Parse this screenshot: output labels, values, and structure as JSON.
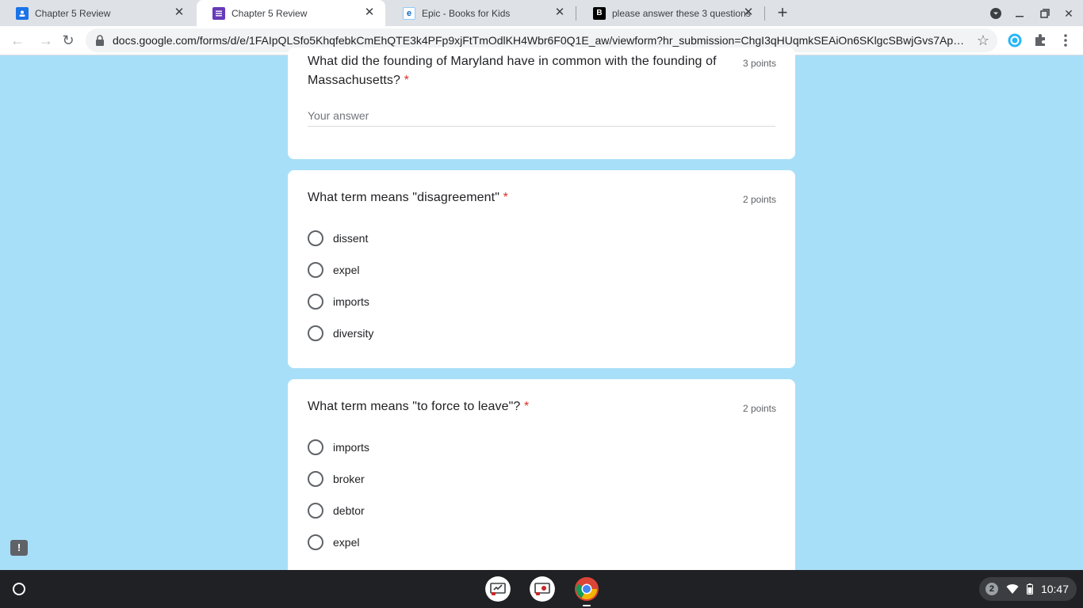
{
  "browser": {
    "tabs": [
      {
        "title": "Chapter 5 Review",
        "favicon": "classroom-icon",
        "active": false
      },
      {
        "title": "Chapter 5 Review",
        "favicon": "forms-icon",
        "active": true
      },
      {
        "title": "Epic - Books for Kids",
        "favicon": "epic-icon",
        "active": false
      },
      {
        "title": "please answer these 3 questions",
        "favicon": "brainly-icon",
        "active": false
      }
    ],
    "url": "docs.google.com/forms/d/e/1FAIpQLSfo5KhqfebkCmEhQTE3k4PFp9xjFtTmOdlKH4Wbr6F0Q1E_aw/viewform?hr_submission=ChgI3qHUqmkSEAiOn6SKlgcSBwjGvs7Apg..."
  },
  "form": {
    "q1": {
      "title": "What did the founding of Maryland have in common with the founding of Massachusetts?",
      "required_mark": "*",
      "points": "3 points",
      "placeholder": "Your answer"
    },
    "q2": {
      "title": "What term means \"disagreement\"",
      "required_mark": "*",
      "points": "2 points",
      "options": [
        "dissent",
        "expel",
        "imports",
        "diversity"
      ]
    },
    "q3": {
      "title": "What term means \"to force to leave\"?",
      "required_mark": "*",
      "points": "2 points",
      "options": [
        "imports",
        "broker",
        "debtor",
        "expel"
      ]
    }
  },
  "shelf": {
    "notification_count": "2",
    "time": "10:47"
  },
  "colors": {
    "page_bg": "#a8dff8",
    "forms_purple": "#673ab7",
    "required_red": "#d93025"
  }
}
